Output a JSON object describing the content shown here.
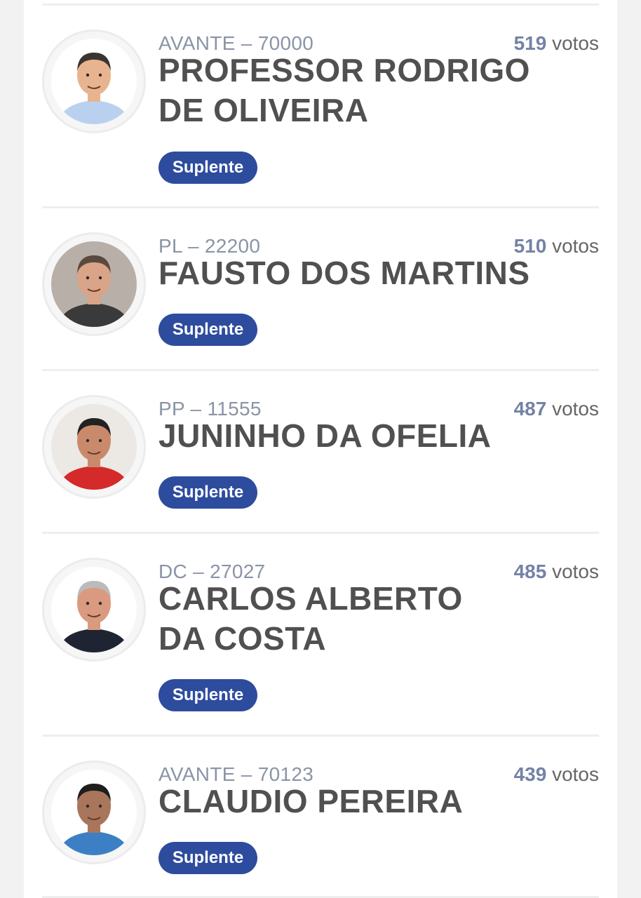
{
  "candidates": [
    {
      "party_number": "AVANTE – 70000",
      "votes_count": "519",
      "votes_label": "votos",
      "name": "PROFESSOR RODRIGO DE OLIVEIRA",
      "status": "Suplente",
      "photo": {
        "skin": "#e8b48f",
        "hair": "#3a3530",
        "shirt": "#b9d1ee",
        "bg": "#ffffff"
      }
    },
    {
      "party_number": "PL – 22200",
      "votes_count": "510",
      "votes_label": "votos",
      "name": "FAUSTO DOS MARTINS",
      "status": "Suplente",
      "photo": {
        "skin": "#d9a487",
        "hair": "#5a4a3e",
        "shirt": "#3a3a3a",
        "bg": "#b8b0a8"
      }
    },
    {
      "party_number": "PP – 11555",
      "votes_count": "487",
      "votes_label": "votos",
      "name": "JUNINHO DA OFELIA",
      "status": "Suplente",
      "photo": {
        "skin": "#c98a6c",
        "hair": "#222222",
        "shirt": "#d42a2a",
        "bg": "#ece8e4"
      }
    },
    {
      "party_number": "DC – 27027",
      "votes_count": "485",
      "votes_label": "votos",
      "name": "CARLOS ALBERTO DA COSTA",
      "status": "Suplente",
      "photo": {
        "skin": "#d99a80",
        "hair": "#bbbbbb",
        "shirt": "#1f2433",
        "bg": "#ffffff"
      }
    },
    {
      "party_number": "AVANTE – 70123",
      "votes_count": "439",
      "votes_label": "votos",
      "name": "CLAUDIO PEREIRA",
      "status": "Suplente",
      "photo": {
        "skin": "#a9765c",
        "hair": "#1e1e1e",
        "shirt": "#3d7fc4",
        "bg": "#ffffff"
      }
    }
  ],
  "icons": {
    "avatar": "candidate-photo"
  },
  "colors": {
    "badge_bg": "#2e4c9d",
    "votes_number": "#7482a6",
    "name_text": "#505050",
    "meta_text": "#8a94a6"
  }
}
